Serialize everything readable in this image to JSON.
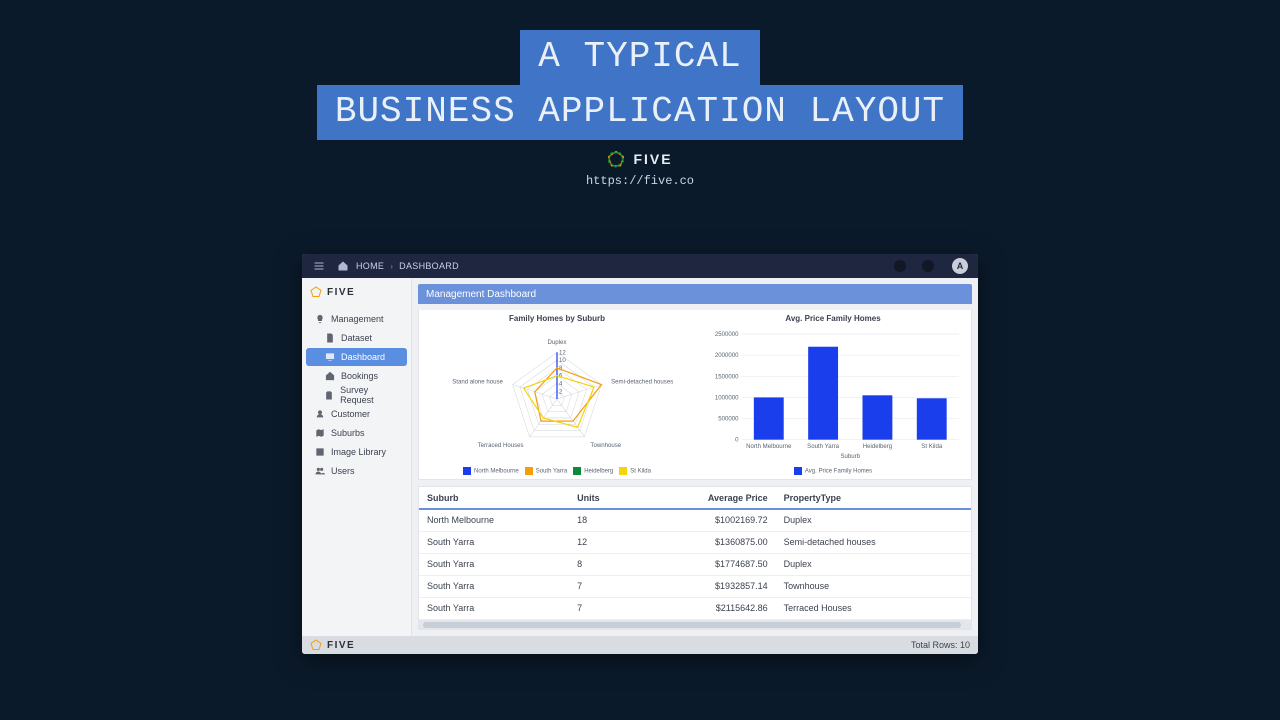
{
  "slide": {
    "title_line1": "A TYPICAL",
    "title_line2": "BUSINESS APPLICATION LAYOUT",
    "brand": "FIVE",
    "url": "https://five.co"
  },
  "topbar": {
    "home": "HOME",
    "crumb": "DASHBOARD",
    "avatar_initial": "A"
  },
  "sidebar": {
    "brand": "FIVE",
    "items": [
      {
        "label": "Management",
        "icon": "bulb"
      },
      {
        "label": "Dataset",
        "icon": "doc",
        "indent": true
      },
      {
        "label": "Dashboard",
        "icon": "monitor",
        "indent": true,
        "active": true
      },
      {
        "label": "Bookings",
        "icon": "home",
        "indent": true
      },
      {
        "label": "Survey Request",
        "icon": "clipboard",
        "indent": true
      },
      {
        "label": "Customer",
        "icon": "user"
      },
      {
        "label": "Suburbs",
        "icon": "map"
      },
      {
        "label": "Image Library",
        "icon": "image"
      },
      {
        "label": "Users",
        "icon": "users"
      }
    ]
  },
  "panel_title": "Management Dashboard",
  "chart_data": [
    {
      "type": "radar",
      "title": "Family Homes by Suburb",
      "categories": [
        "Duplex",
        "Semi-detached houses",
        "Townhouse",
        "Terraced Houses",
        "Stand alone house"
      ],
      "rings": [
        2,
        4,
        6,
        8,
        10,
        12
      ],
      "max": 12,
      "series": [
        {
          "name": "North Melbourne",
          "color": "#1b3eec",
          "values": [
            12,
            0,
            0,
            0,
            0
          ]
        },
        {
          "name": "South Yarra",
          "color": "#f59e0b",
          "values": [
            8,
            12,
            7,
            7,
            6
          ]
        },
        {
          "name": "Heidelberg",
          "color": "#0a8a3a",
          "values": [
            0,
            0,
            0,
            0,
            0
          ]
        },
        {
          "name": "St Kilda",
          "color": "#f4d40a",
          "values": [
            6,
            10,
            9,
            6,
            9
          ]
        }
      ]
    },
    {
      "type": "bar",
      "title": "Avg. Price Family Homes",
      "xlabel": "Suburb",
      "ylabel": "",
      "ylim": [
        0,
        2500000
      ],
      "yticks": [
        0,
        500000,
        1000000,
        1500000,
        2000000,
        2500000
      ],
      "categories": [
        "North Melbourne",
        "South Yarra",
        "Heidelberg",
        "St Kilda"
      ],
      "series": [
        {
          "name": "Avg. Price Family Homes",
          "color": "#1b3eec",
          "values": [
            1000000,
            2200000,
            1050000,
            980000
          ]
        }
      ]
    }
  ],
  "table": {
    "columns": [
      "Suburb",
      "Units",
      "Average Price",
      "PropertyType"
    ],
    "rows": [
      {
        "suburb": "North Melbourne",
        "units": "18",
        "avg": "$1002169.72",
        "type": "Duplex"
      },
      {
        "suburb": "South Yarra",
        "units": "12",
        "avg": "$1360875.00",
        "type": "Semi-detached houses"
      },
      {
        "suburb": "South Yarra",
        "units": "8",
        "avg": "$1774687.50",
        "type": "Duplex"
      },
      {
        "suburb": "South Yarra",
        "units": "7",
        "avg": "$1932857.14",
        "type": "Townhouse"
      },
      {
        "suburb": "South Yarra",
        "units": "7",
        "avg": "$2115642.86",
        "type": "Terraced Houses"
      }
    ]
  },
  "footer": {
    "brand": "FIVE",
    "total_rows_label": "Total Rows:",
    "total_rows_value": "10"
  }
}
